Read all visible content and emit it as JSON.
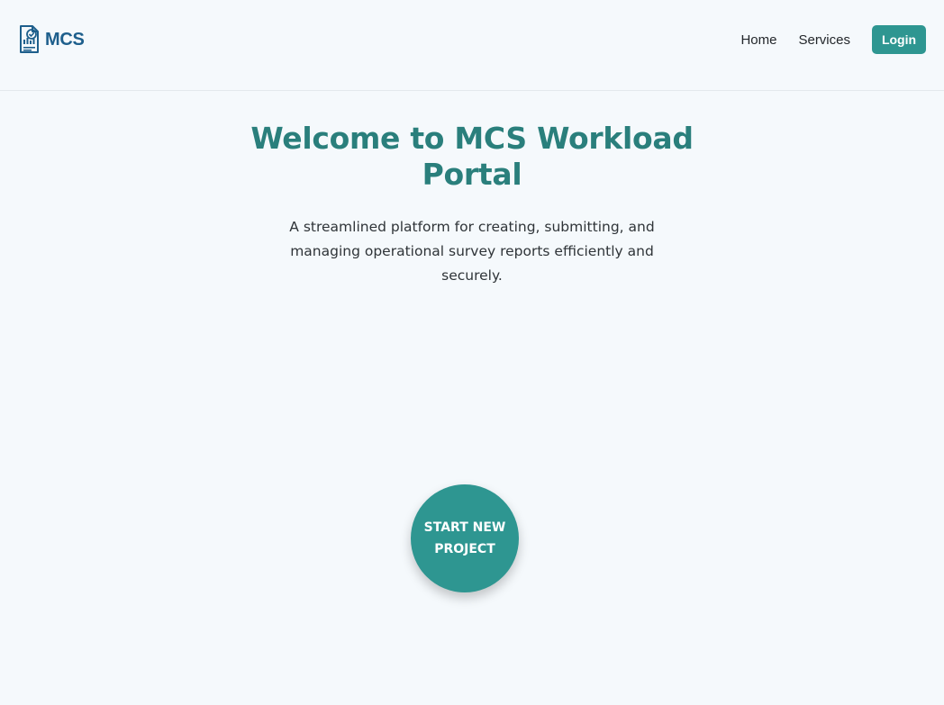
{
  "header": {
    "logo_text": "MCS",
    "nav": [
      {
        "label": "Home"
      },
      {
        "label": "Services"
      }
    ],
    "login_label": "Login"
  },
  "hero": {
    "title": "Welcome to MCS Workload Portal",
    "subtitle": "A streamlined platform for creating, submitting, and managing operational survey reports efficiently and securely."
  },
  "cta": {
    "label": "START NEW PROJECT"
  },
  "colors": {
    "accent": "#2e9691",
    "title": "#2a7f7c",
    "logo": "#1e5f8c",
    "background": "#f5f9fc"
  },
  "icons": {
    "logo": "report-document-icon"
  }
}
